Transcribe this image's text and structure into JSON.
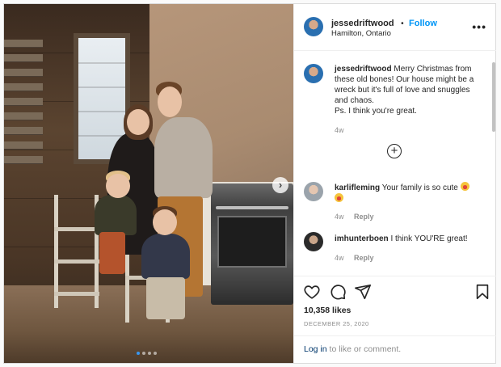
{
  "post": {
    "username": "jessedriftwood",
    "follow_label": "Follow",
    "separator": "•",
    "location": "Hamilton, Ontario",
    "more_label": "•••",
    "carousel": {
      "slide_count": 4,
      "active_index": 0
    }
  },
  "caption": {
    "username": "jessedriftwood",
    "text": "Merry Christmas from these old bones! Our house might be a wreck but it's full of love and snuggles and chaos.",
    "ps": "Ps. I think you're great.",
    "age": "4w"
  },
  "load_more_label": "+",
  "comments": [
    {
      "username": "karlifleming",
      "text": "Your family is so cute",
      "emoji": "heart-eyes-emoji",
      "age": "4w",
      "reply_label": "Reply"
    },
    {
      "username": "imhunterboen",
      "text": "I think YOU'RE great!",
      "age": "4w",
      "reply_label": "Reply"
    }
  ],
  "stats": {
    "likes": "10,358 likes",
    "date": "DECEMBER 25, 2020"
  },
  "footer": {
    "login_link": "Log in",
    "login_text": "to like or comment."
  },
  "colors": {
    "accent": "#0095f6",
    "link": "#00376b",
    "muted": "#8e8e8e",
    "text": "#262626",
    "border": "#dbdbdb"
  },
  "icons": [
    "heart-icon",
    "comment-icon",
    "share-icon",
    "bookmark-icon",
    "next-arrow-icon",
    "more-options-icon",
    "add-comment-icon"
  ]
}
